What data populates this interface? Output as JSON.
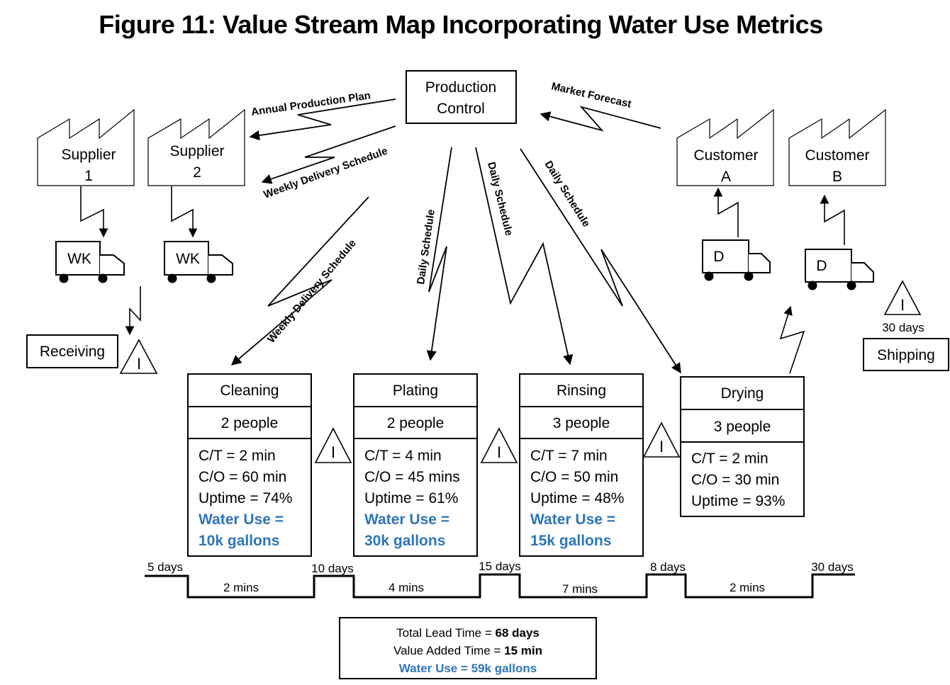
{
  "title": "Figure 11: Value Stream Map Incorporating Water Use Metrics",
  "production_control": {
    "line1": "Production",
    "line2": "Control"
  },
  "suppliers": [
    {
      "line1": "Supplier",
      "line2": "1",
      "truck": "WK"
    },
    {
      "line1": "Supplier",
      "line2": "2",
      "truck": "WK"
    }
  ],
  "customers": [
    {
      "line1": "Customer",
      "line2": "A",
      "truck": "D"
    },
    {
      "line1": "Customer",
      "line2": "B",
      "truck": "D"
    }
  ],
  "info_flows": {
    "annual_plan": "Annual Production Plan",
    "weekly_delivery_suppliers": "Weekly Delivery Schedule",
    "weekly_delivery_cleaning": "Weekly Delivery Schedule",
    "daily_plating": "Daily Schedule",
    "daily_rinsing": "Daily Schedule",
    "daily_drying": "Daily Schedule",
    "market_forecast": "Market Forecast"
  },
  "receiving": {
    "label": "Receiving",
    "inventory_symbol": "I"
  },
  "shipping": {
    "label": "Shipping",
    "inventory_symbol": "I",
    "inventory_days": "30 days"
  },
  "processes": [
    {
      "name": "Cleaning",
      "people": "2 people",
      "ct": "C/T = 2 min",
      "co": "C/O = 60 min",
      "uptime": "Uptime = 74%",
      "water1": "Water Use =",
      "water2": "10k gallons"
    },
    {
      "name": "Plating",
      "people": "2 people",
      "ct": "C/T = 4 min",
      "co": "C/O = 45 mins",
      "uptime": "Uptime = 61%",
      "water1": "Water Use =",
      "water2": "30k gallons"
    },
    {
      "name": "Rinsing",
      "people": "3 people",
      "ct": "C/T = 7 min",
      "co": "C/O = 50 min",
      "uptime": "Uptime = 48%",
      "water1": "Water Use =",
      "water2": "15k gallons"
    },
    {
      "name": "Drying",
      "people": "3 people",
      "ct": "C/T = 2 min",
      "co": "C/O = 30 min",
      "uptime": "Uptime = 93%"
    }
  ],
  "inventory_symbol": "I",
  "timeline": {
    "lead_times": [
      "5 days",
      "10 days",
      "15 days",
      "8 days",
      "30 days"
    ],
    "process_times": [
      "2 mins",
      "4 mins",
      "7 mins",
      "2 mins"
    ]
  },
  "summary": {
    "lead_label": "Total Lead Time = ",
    "lead_value": "68 days",
    "va_label": "Value Added Time = ",
    "va_value": "15 min",
    "water": "Water Use = 59k gallons"
  },
  "colors": {
    "water_blue": "#2E75B6",
    "line": "#000000"
  }
}
